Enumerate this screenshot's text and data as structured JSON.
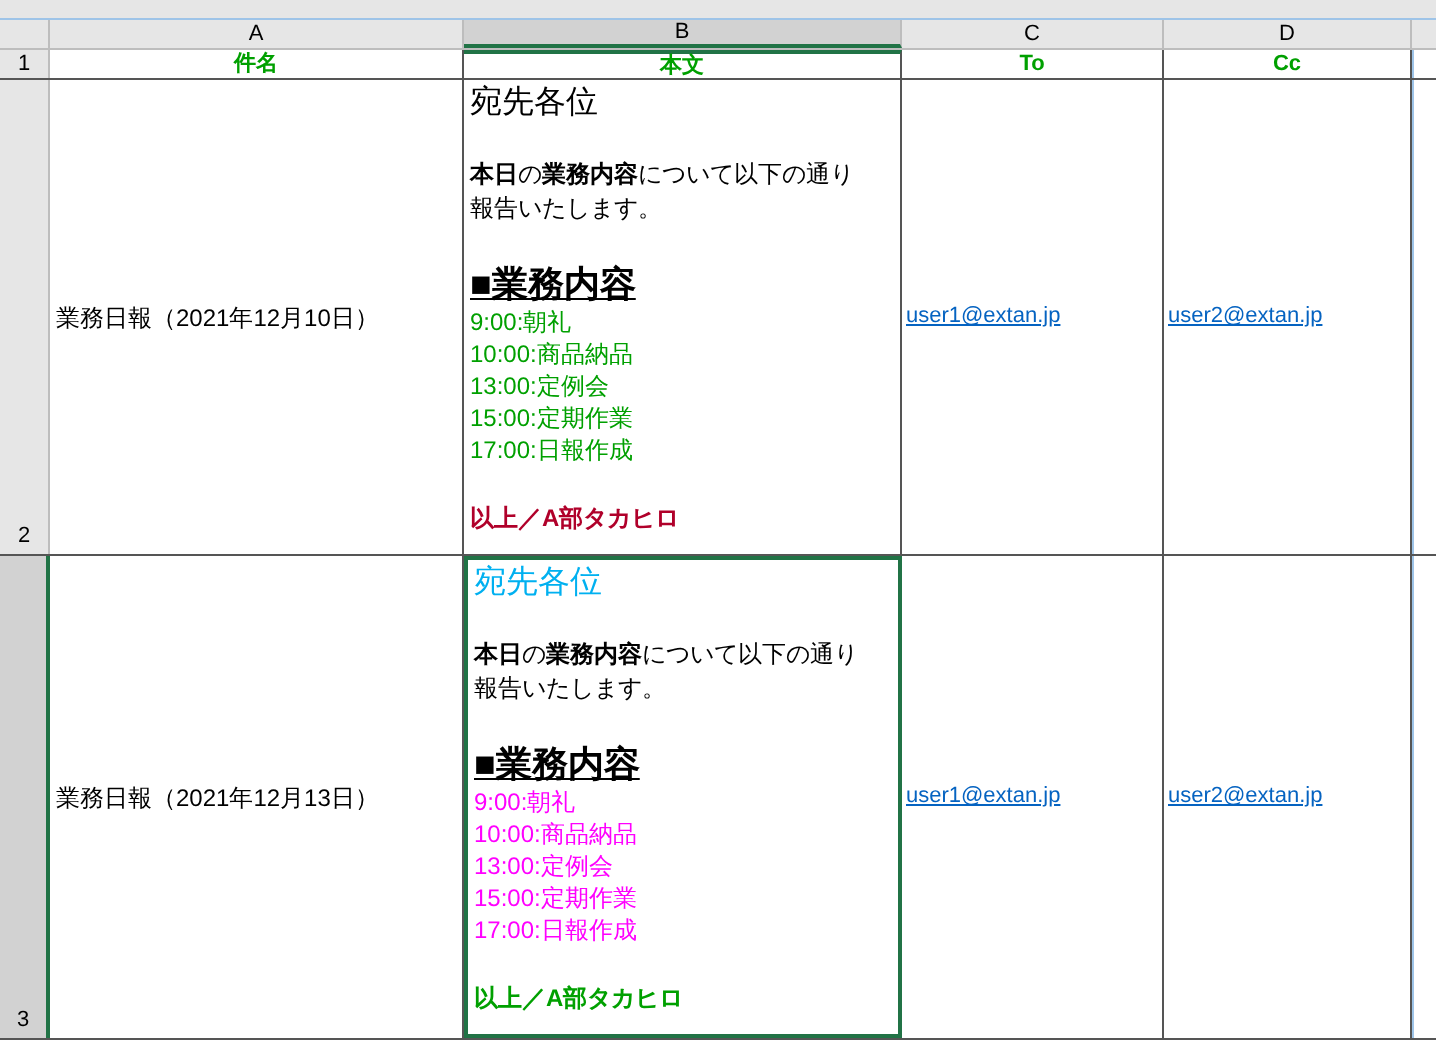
{
  "columns": [
    {
      "label": "A",
      "selected": false
    },
    {
      "label": "B",
      "selected": true
    },
    {
      "label": "C",
      "selected": false
    },
    {
      "label": "D",
      "selected": false
    }
  ],
  "header_row": {
    "number": "1",
    "cells": [
      "件名",
      "本文",
      "To",
      "Cc"
    ]
  },
  "rows": [
    {
      "number": "2",
      "selected": false,
      "subject": "業務日報（2021年12月10日）",
      "body": {
        "greeting": {
          "text": "宛先各位",
          "color": "#000000"
        },
        "intro": "**本日**の**業務内容**について以下の通り報告いたします。",
        "heading": "■業務内容",
        "items": [
          {
            "text": "9:00:朝礼",
            "color": "#00a000"
          },
          {
            "text": "10:00:商品納品",
            "color": "#00a000"
          },
          {
            "text": "13:00:定例会",
            "color": "#00a000"
          },
          {
            "text": "15:00:定期作業",
            "color": "#00a000"
          },
          {
            "text": "17:00:日報作成",
            "color": "#00a000"
          }
        ],
        "signature": {
          "text": "以上／A部タカヒロ",
          "color": "#b0002a"
        }
      },
      "to": "user1@extan.jp",
      "cc": "user2@extan.jp"
    },
    {
      "number": "3",
      "selected": true,
      "subject": "業務日報（2021年12月13日）",
      "body": {
        "greeting": {
          "text": "宛先各位",
          "color": "#00b0f0"
        },
        "intro": "**本日**の**業務内容**について以下の通り報告いたします。",
        "heading": "■業務内容",
        "items": [
          {
            "text": "9:00:朝礼",
            "color": "#ff00ff"
          },
          {
            "text": "10:00:商品納品",
            "color": "#ff00ff"
          },
          {
            "text": "13:00:定例会",
            "color": "#ff00ff"
          },
          {
            "text": "15:00:定期作業",
            "color": "#ff00ff"
          },
          {
            "text": "17:00:日報作成",
            "color": "#ff00ff"
          }
        ],
        "signature": {
          "text": "以上／A部タカヒロ",
          "color": "#00a000"
        }
      },
      "to": "user1@extan.jp",
      "cc": "user2@extan.jp"
    }
  ]
}
